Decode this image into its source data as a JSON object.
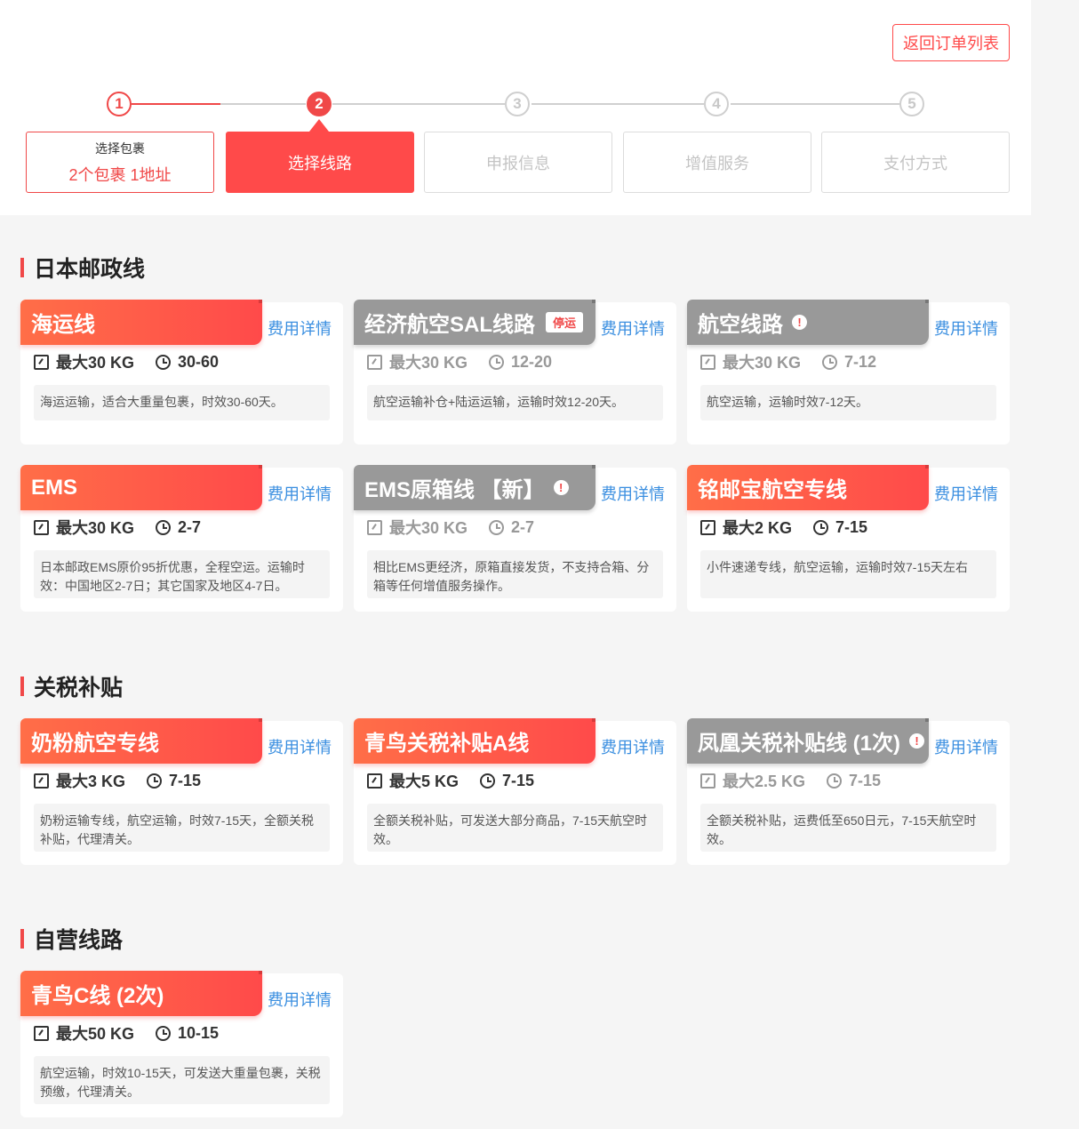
{
  "header": {
    "back_label": "返回订单列表"
  },
  "steps": [
    {
      "num": "1",
      "label_line1": "选择包裹",
      "label_line2": "2个包裹 1地址"
    },
    {
      "num": "2",
      "label": "选择线路"
    },
    {
      "num": "3",
      "label": "申报信息"
    },
    {
      "num": "4",
      "label": "增值服务"
    },
    {
      "num": "5",
      "label": "支付方式"
    }
  ],
  "fee_label": "费用详情",
  "sections": [
    {
      "title": "日本邮政线",
      "routes": [
        {
          "name": "海运线",
          "style": "red",
          "weight": "最大30 KG",
          "days": "30-60",
          "desc": "海运运输，适合大重量包裹，时效30-60天。"
        },
        {
          "name": "经济航空SAL线路",
          "style": "gray",
          "badge": "停运",
          "weight": "最大30 KG",
          "days": "12-20",
          "desc": "航空运输补仓+陆运运输，运输时效12-20天。"
        },
        {
          "name": "航空线路",
          "style": "gray",
          "warn": "!",
          "weight": "最大30 KG",
          "days": "7-12",
          "desc": "航空运输，运输时效7-12天。"
        },
        {
          "name": "EMS",
          "style": "red",
          "weight": "最大30 KG",
          "days": "2-7",
          "desc": "日本邮政EMS原价95折优惠，全程空运。运输时效：中国地区2-7日；其它国家及地区4-7日。"
        },
        {
          "name": "EMS原箱线 【新】",
          "style": "gray",
          "warn": "!",
          "weight": "最大30 KG",
          "days": "2-7",
          "desc": "相比EMS更经济，原箱直接发货，不支持合箱、分箱等任何增值服务操作。"
        },
        {
          "name": "铭邮宝航空专线",
          "style": "red",
          "weight": "最大2 KG",
          "days": "7-15",
          "desc": "小件速递专线，航空运输，运输时效7-15天左右"
        }
      ]
    },
    {
      "title": "关税补贴",
      "routes": [
        {
          "name": "奶粉航空专线",
          "style": "red",
          "weight": "最大3 KG",
          "days": "7-15",
          "desc": "奶粉运输专线，航空运输，时效7-15天，全额关税补贴，代理清关。"
        },
        {
          "name": "青鸟关税补贴A线",
          "style": "red",
          "weight": "最大5 KG",
          "days": "7-15",
          "desc": "全额关税补贴，可发送大部分商品，7-15天航空时效。"
        },
        {
          "name": "凤凰关税补贴线 (1次)",
          "style": "gray",
          "warn": "!",
          "weight": "最大2.5 KG",
          "days": "7-15",
          "desc": "全额关税补贴，运费低至650日元，7-15天航空时效。"
        }
      ]
    },
    {
      "title": "自营线路",
      "routes": [
        {
          "name": "青鸟C线 (2次)",
          "style": "red",
          "weight": "最大50 KG",
          "days": "10-15",
          "desc": "航空运输，时效10-15天，可发送大重量包裹，关税预缴，代理清关。"
        }
      ]
    }
  ]
}
